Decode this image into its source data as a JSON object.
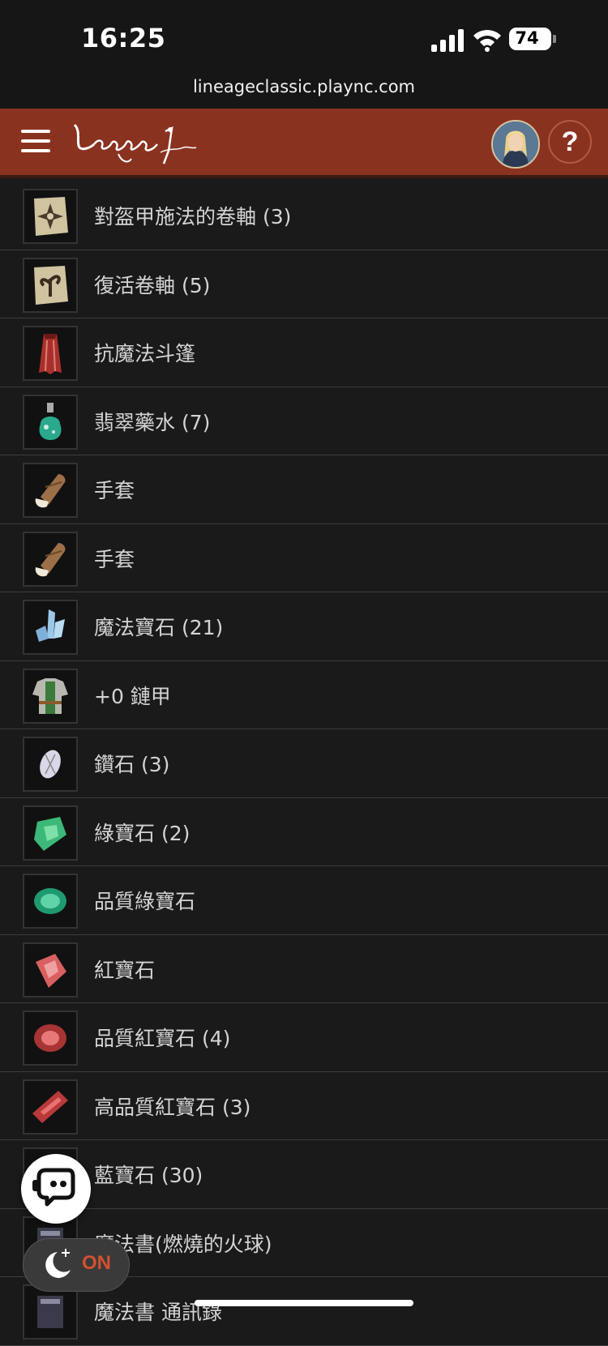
{
  "status_bar": {
    "time": "16:25",
    "battery": "74"
  },
  "browser": {
    "url": "lineageclassic.plaync.com"
  },
  "header": {
    "logo_alt": "Lineage Classic"
  },
  "items": [
    {
      "name": "對盔甲施法的卷軸 (3)",
      "icon": "scroll-armor-icon"
    },
    {
      "name": "復活卷軸 (5)",
      "icon": "scroll-resurrection-icon"
    },
    {
      "name": "抗魔法斗篷",
      "icon": "cloak-icon"
    },
    {
      "name": "翡翠藥水 (7)",
      "icon": "emerald-potion-icon"
    },
    {
      "name": "手套",
      "icon": "glove-icon"
    },
    {
      "name": "手套",
      "icon": "glove-icon"
    },
    {
      "name": "魔法寶石 (21)",
      "icon": "magic-crystal-icon"
    },
    {
      "name": "+0 鏈甲",
      "icon": "chainmail-icon"
    },
    {
      "name": "鑽石 (3)",
      "icon": "diamond-icon"
    },
    {
      "name": "綠寶石 (2)",
      "icon": "emerald-icon"
    },
    {
      "name": "品質綠寶石",
      "icon": "quality-emerald-icon"
    },
    {
      "name": "紅寶石",
      "icon": "ruby-icon"
    },
    {
      "name": "品質紅寶石 (4)",
      "icon": "quality-ruby-icon"
    },
    {
      "name": "高品質紅寶石 (3)",
      "icon": "high-quality-ruby-icon"
    },
    {
      "name": "藍寶石 (30)",
      "icon": "sapphire-icon"
    },
    {
      "name": "魔法書(燃燒的火球)",
      "icon": "spellbook-icon"
    },
    {
      "name": "魔法書 通訊錄",
      "icon": "spellbook-icon"
    }
  ],
  "dark_mode": {
    "label": "ON"
  },
  "colors": {
    "header_bg": "#8a3220",
    "page_bg": "#1a1a1a",
    "accent": "#d2512f"
  }
}
